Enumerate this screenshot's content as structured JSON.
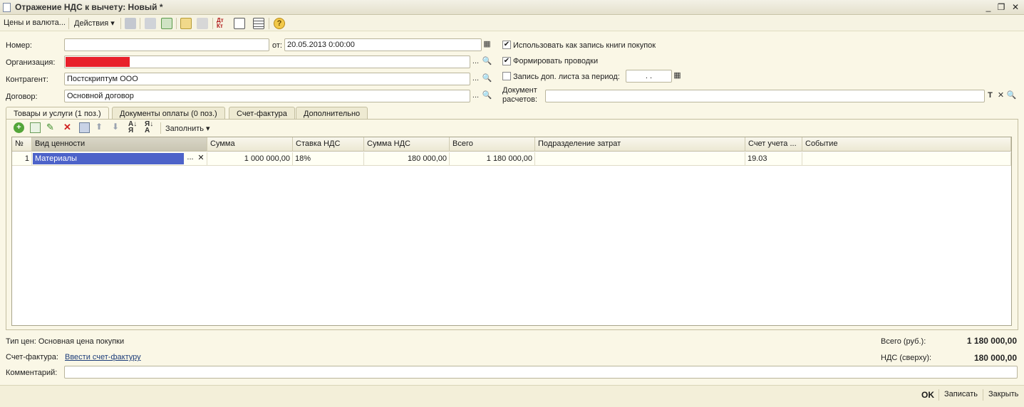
{
  "window": {
    "title": "Отражение НДС к вычету: Новый *",
    "minimize": "_",
    "restore": "❐",
    "close": "✕"
  },
  "toolbar": {
    "prices_currency": "Цены и валюта...",
    "actions": "Действия ▾"
  },
  "form": {
    "number_label": "Номер:",
    "number_value": "",
    "date_label": "от:",
    "date_value": "20.05.2013  0:00:00",
    "org_label": "Организация:",
    "org_value": "",
    "contractor_label": "Контрагент:",
    "contractor_value": "Постскриптум ООО",
    "contract_label": "Договор:",
    "contract_value": "Основной договор",
    "use_purchase_book_label": "Использовать как запись книги покупок",
    "use_purchase_book_checked": true,
    "form_postings_label": "Формировать проводки",
    "form_postings_checked": true,
    "add_sheet_label": "Запись доп. листа за период:",
    "add_sheet_checked": false,
    "add_sheet_period": ". .",
    "settlement_doc_label_1": "Документ",
    "settlement_doc_label_2": "расчетов:",
    "settlement_doc_value": "",
    "btn_select": "...",
    "btn_open": "🔍",
    "btn_clear": "✕",
    "btn_type": "T"
  },
  "tabs": [
    {
      "label": "Товары и услуги (1 поз.)",
      "active": true
    },
    {
      "label": "Документы оплаты (0 поз.)",
      "active": false
    },
    {
      "label": "Счет-фактура",
      "active": false
    },
    {
      "label": "Дополнительно",
      "active": false
    }
  ],
  "table_toolbar": {
    "fill_label": "Заполнить ▾"
  },
  "table": {
    "headers": [
      "№",
      "Вид ценности",
      "Сумма",
      "Ставка НДС",
      "Сумма НДС",
      "Всего",
      "Подразделение затрат",
      "Счет учета ...",
      "Событие"
    ],
    "rows": [
      {
        "num": "1",
        "kind": "Материалы",
        "sum": "1 000 000,00",
        "vat_rate": "18%",
        "vat_sum": "180 000,00",
        "total": "1 180 000,00",
        "division": "",
        "account": "19.03",
        "event": ""
      }
    ]
  },
  "footer": {
    "price_type": "Тип цен: Основная цена покупки",
    "invoice_label": "Счет-фактура:",
    "invoice_link": "Ввести счет-фактуру",
    "comment_label": "Комментарий:",
    "comment_value": "",
    "total_label": "Всего (руб.):",
    "total_value": "1 180 000,00",
    "vat_label": "НДС (сверху):",
    "vat_value": "180 000,00"
  },
  "bottom": {
    "ok": "OK",
    "save": "Записать",
    "close": "Закрыть"
  },
  "colors": {
    "org_redaction": "#e8202a",
    "selected_cell": "#4d63c9",
    "panel_bg": "#faf7e6"
  }
}
